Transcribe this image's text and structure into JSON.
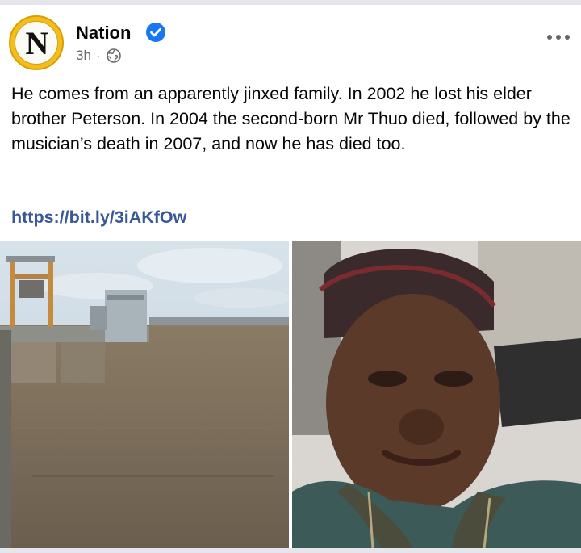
{
  "post": {
    "page_name": "Nation",
    "avatar_letter": "N",
    "time": "3h",
    "separator": "·",
    "privacy_icon": "globe-icon",
    "verified_icon": "verified-badge-icon",
    "more_icon": "more-options-icon",
    "text": "He comes from an apparently jinxed family. In 2002 he lost his elder brother Peterson. In 2004 the second-born Mr Thuo died, followed by the musician’s death in 2007, and now he has died too.",
    "link": "https://bit.ly/3iAKfOw"
  },
  "photos": [
    {
      "name": "dam-photo"
    },
    {
      "name": "man-portrait-photo"
    }
  ],
  "colors": {
    "link": "#385898",
    "verified": "#1877f2",
    "meta": "#65676b",
    "avatar_ring": "#f5bd19"
  }
}
